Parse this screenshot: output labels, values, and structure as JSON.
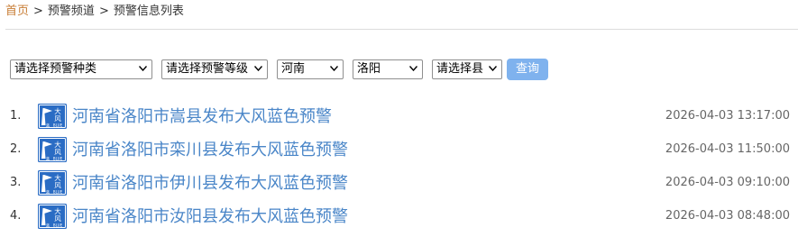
{
  "breadcrumb": {
    "home": "首页",
    "separator": ">",
    "channel": "预警频道",
    "current": "预警信息列表"
  },
  "filters": {
    "type_selected": "请选择预警种类",
    "level_selected": "请选择预警等级",
    "province_selected": "河南",
    "city_selected": "洛阳",
    "county_selected": "请选择县",
    "query_label": "查询"
  },
  "icon": {
    "name": "wind-blue-warning-icon",
    "top_text": "大",
    "bottom_text": "风",
    "small_text": "蓝",
    "code_text": "BLUE",
    "bg_color": "#2a6cc4"
  },
  "alerts": [
    {
      "index": "1.",
      "title": "河南省洛阳市嵩县发布大风蓝色预警",
      "time": "2026-04-03 13:17:00"
    },
    {
      "index": "2.",
      "title": "河南省洛阳市栾川县发布大风蓝色预警",
      "time": "2026-04-03 11:50:00"
    },
    {
      "index": "3.",
      "title": "河南省洛阳市伊川县发布大风蓝色预警",
      "time": "2026-04-03 09:10:00"
    },
    {
      "index": "4.",
      "title": "河南省洛阳市汝阳县发布大风蓝色预警",
      "time": "2026-04-03 08:48:00"
    }
  ]
}
